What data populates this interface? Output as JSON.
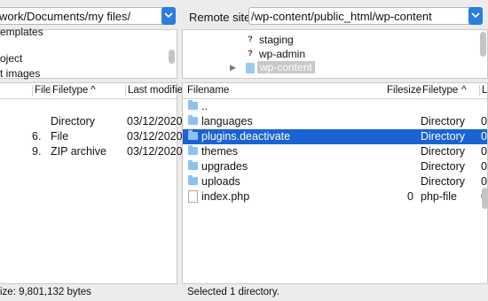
{
  "local": {
    "path": "work/Documents/my files/",
    "tree": [
      "emplates",
      "oject",
      "t images"
    ],
    "columns": {
      "filesize": "File",
      "filetype": "Filetype",
      "modified": "Last modifie"
    },
    "rows": [
      {
        "size": "",
        "type": "Directory",
        "date": "03/12/2020"
      },
      {
        "size": "6.",
        "type": "File",
        "date": "03/12/2020"
      },
      {
        "size": "9.",
        "type": "ZIP archive",
        "date": "03/12/2020"
      }
    ],
    "status": "ize: 9,801,132 bytes"
  },
  "remote": {
    "site_label": "Remote site:",
    "path": "/wp-content/public_html/wp-content",
    "tree": [
      "staging",
      "wp-admin",
      "wp-content"
    ],
    "columns": {
      "filename": "Filename",
      "filesize": "Filesize",
      "filetype": "Filetype",
      "last": "L"
    },
    "rows": [
      {
        "name": "..",
        "size": "",
        "type": "",
        "extra": "",
        "icon": "folder"
      },
      {
        "name": "languages",
        "size": "",
        "type": "Directory",
        "extra": "0",
        "icon": "folder"
      },
      {
        "name": "plugins.deactivate",
        "size": "",
        "type": "Directory",
        "extra": "0",
        "icon": "folder",
        "selected": true
      },
      {
        "name": "themes",
        "size": "",
        "type": "Directory",
        "extra": "0",
        "icon": "folder"
      },
      {
        "name": "upgrades",
        "size": "",
        "type": "Directory",
        "extra": "0",
        "icon": "folder"
      },
      {
        "name": "uploads",
        "size": "",
        "type": "Directory",
        "extra": "0",
        "icon": "folder"
      },
      {
        "name": "index.php",
        "size": "0",
        "type": "php-file",
        "extra": "0",
        "icon": "file"
      }
    ],
    "status": "Selected 1 directory."
  },
  "colors": {
    "accent": "#2a7de1",
    "selection": "#1a63d3"
  }
}
